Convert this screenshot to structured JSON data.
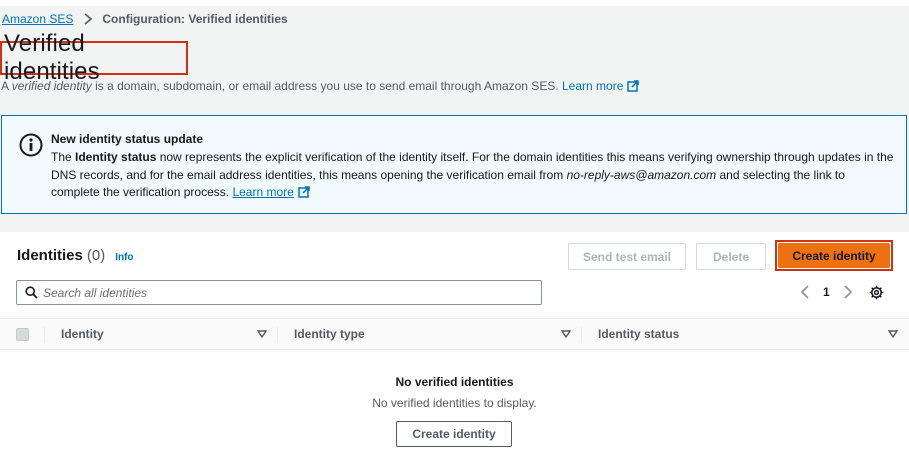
{
  "breadcrumb": {
    "root": "Amazon SES",
    "current": "Configuration: Verified identities"
  },
  "page": {
    "title": "Verified identities",
    "desc_prefix": "A ",
    "desc_term": "verified identity",
    "desc_suffix": " is a domain, subdomain, or email address you use to send email through Amazon SES.",
    "learn_more": "Learn more"
  },
  "alert": {
    "title": "New identity status update",
    "body_1": "The ",
    "body_bold": "Identity status",
    "body_2": " now represents the explicit verification of the identity itself. For the domain identities this means verifying ownership through updates in the DNS records, and for the email address identities, this means opening the verification email from ",
    "body_email": "no-reply-aws@amazon.com",
    "body_3": " and selecting the link to complete the verification process.",
    "learn_more": "Learn more"
  },
  "identities": {
    "title": "Identities",
    "count": "(0)",
    "info": "Info",
    "send_test_email": "Send test email",
    "delete": "Delete",
    "create_identity": "Create identity",
    "search_placeholder": "Search all identities",
    "page": "1",
    "columns": [
      "Identity",
      "Identity type",
      "Identity status"
    ],
    "empty_title": "No verified identities",
    "empty_desc": "No verified identities to display.",
    "empty_button": "Create identity"
  },
  "colors": {
    "link": "#0073bb",
    "primary": "#ec7211",
    "highlight": "#d13212",
    "alert_bg": "#f1faff"
  },
  "icons": [
    "chevron-right-icon",
    "external-link-icon",
    "info-circle-icon",
    "search-icon",
    "chevron-left-icon",
    "gear-icon",
    "caret-down-icon"
  ]
}
